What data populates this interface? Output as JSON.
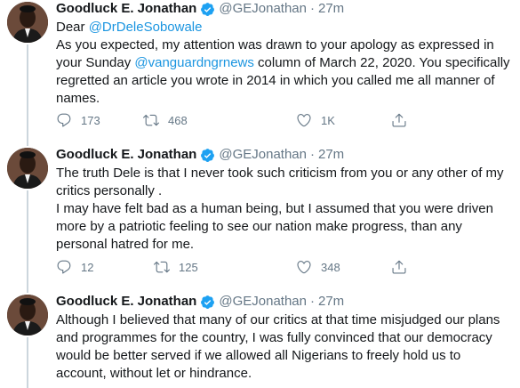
{
  "colors": {
    "link": "#1b95e0",
    "secondary": "#657786",
    "verified": "#1da1f2",
    "text": "#14171a"
  },
  "tweets": [
    {
      "name": "Goodluck E. Jonathan",
      "handle": "@GEJonathan",
      "dot": "·",
      "time": "27m",
      "body_parts": [
        "Dear ",
        "@DrDeleSobowale",
        "\nAs you expected, my attention was drawn to your apology as expressed in\nyour Sunday ",
        "@vanguardngrnews",
        " column of March 22, 2020. You specifically\nregretted an article you wrote in 2014 in which you called me all manner of\nnames."
      ],
      "replies": "173",
      "retweets": "468",
      "likes": "1K"
    },
    {
      "name": "Goodluck E. Jonathan",
      "handle": "@GEJonathan",
      "dot": "·",
      "time": "27m",
      "body": "The truth Dele is that I never took such criticism from you or any other of my\ncritics personally .\nI may have felt bad as a human being, but I assumed that you were driven\nmore by a patriotic feeling to see our nation make progress, than any\npersonal hatred for me.",
      "replies": "12",
      "retweets": "125",
      "likes": "348"
    },
    {
      "name": "Goodluck E. Jonathan",
      "handle": "@GEJonathan",
      "dot": "·",
      "time": "27m",
      "body": "Although I believed that many of our critics at that time misjudged our plans\nand programmes for the country, I was fully convinced that our democracy\nwould be better served if we allowed all Nigerians to freely hold us to\naccount, without let or hindrance."
    }
  ]
}
